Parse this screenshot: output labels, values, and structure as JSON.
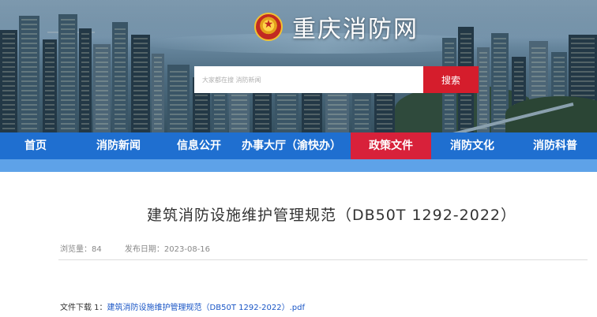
{
  "header": {
    "site_title": "重庆消防网",
    "emblem_icon": "fire-rescue-emblem-icon"
  },
  "search": {
    "placeholder": "大家都在搜 消防新闻",
    "button_label": "搜索"
  },
  "nav": {
    "items": [
      {
        "label": "首页",
        "active": false
      },
      {
        "label": "消防新闻",
        "active": false
      },
      {
        "label": "信息公开",
        "active": false
      },
      {
        "label": "办事大厅（渝快办）",
        "active": false
      },
      {
        "label": "政策文件",
        "active": true
      },
      {
        "label": "消防文化",
        "active": false
      },
      {
        "label": "消防科普",
        "active": false
      }
    ]
  },
  "article": {
    "title": "建筑消防设施维护管理规范（DB50T 1292-2022）",
    "views_label": "浏览量：84",
    "date_label": "发布日期：2023-08-16",
    "download_prefix": "文件下载 1：",
    "download_link": "建筑消防设施维护管理规范（DB50T 1292-2022）.pdf"
  },
  "colors": {
    "nav_bg": "#1f6fd0",
    "nav_active": "#d8213a",
    "search_button": "#d51d2c",
    "link": "#1a56c6"
  }
}
